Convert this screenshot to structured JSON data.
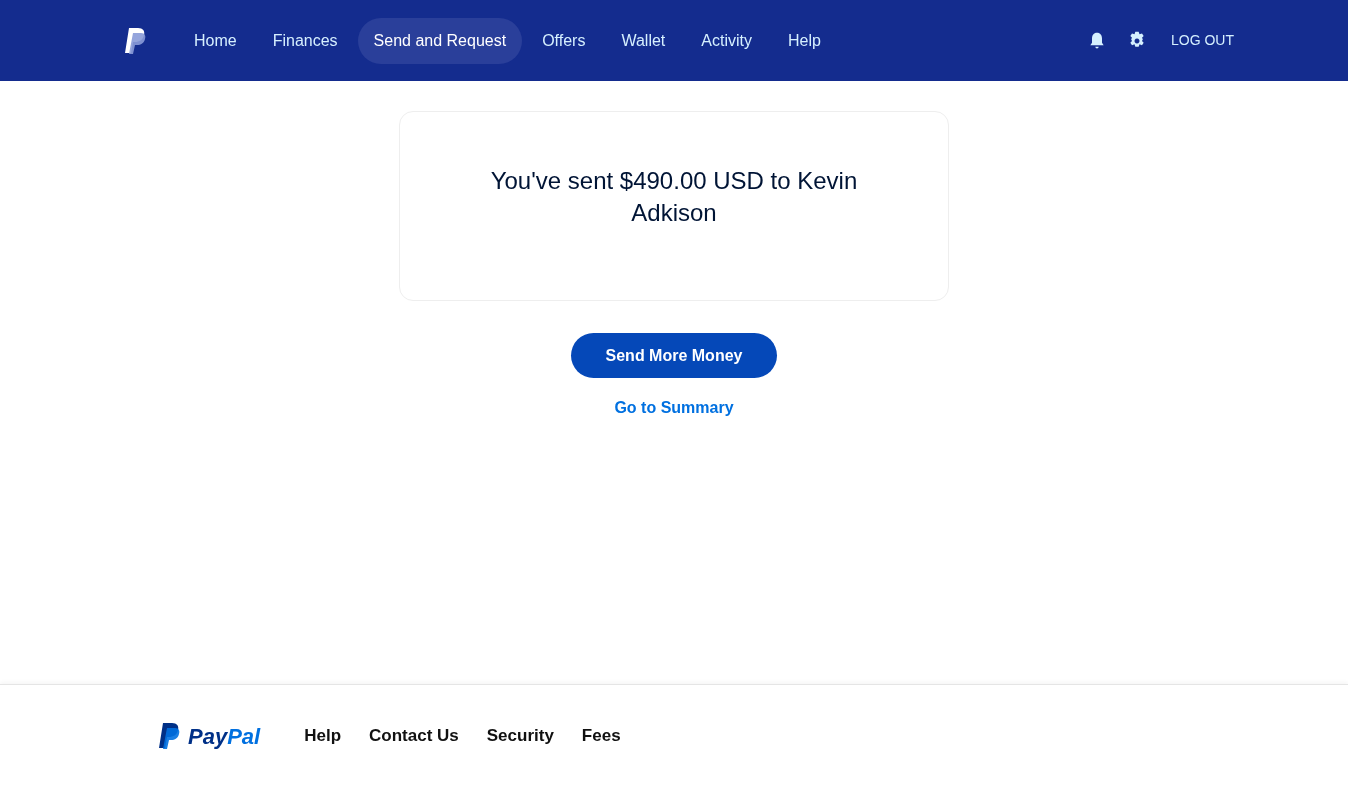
{
  "nav": {
    "items": [
      {
        "label": "Home",
        "selected": false
      },
      {
        "label": "Finances",
        "selected": false
      },
      {
        "label": "Send and Request",
        "selected": true
      },
      {
        "label": "Offers",
        "selected": false
      },
      {
        "label": "Wallet",
        "selected": false
      },
      {
        "label": "Activity",
        "selected": false
      },
      {
        "label": "Help",
        "selected": false
      }
    ],
    "logout": "LOG OUT"
  },
  "confirmation": {
    "message": "You've sent $490.00 USD to Kevin Adkison"
  },
  "primary_button": "Send More Money",
  "summary_link": "Go to Summary",
  "footer": {
    "logo": {
      "part_1": "Pay",
      "part_2": "Pal"
    },
    "links": [
      "Help",
      "Contact Us",
      "Security",
      "Fees"
    ]
  }
}
